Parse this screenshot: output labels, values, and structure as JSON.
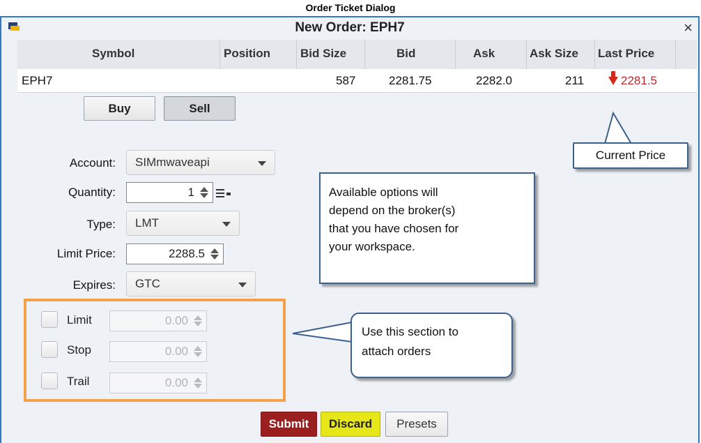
{
  "caption": "Order Ticket Dialog",
  "window": {
    "title": "New Order: EPH7",
    "close_glyph": "×"
  },
  "grid": {
    "headers": [
      "Symbol",
      "Position",
      "Bid Size",
      "Bid",
      "Ask",
      "Ask Size",
      "Last Price"
    ],
    "row": {
      "symbol": "EPH7",
      "position": "",
      "bid_size": "587",
      "bid": "2281.75",
      "ask": "2282.0",
      "ask_size": "211",
      "last_price": "2281.5",
      "last_price_direction": "down"
    }
  },
  "side_buttons": {
    "buy": "Buy",
    "sell": "Sell",
    "selected": "Sell"
  },
  "form": {
    "account_label": "Account:",
    "account_value": "SIMmwaveapi",
    "quantity_label": "Quantity:",
    "quantity_value": "1",
    "type_label": "Type:",
    "type_value": "LMT",
    "limit_price_label": "Limit Price:",
    "limit_price_value": "2288.5",
    "expires_label": "Expires:",
    "expires_value": "GTC"
  },
  "attached_orders": [
    {
      "label": "Limit",
      "value": "0.00"
    },
    {
      "label": "Stop",
      "value": "0.00"
    },
    {
      "label": "Trail",
      "value": "0.00"
    }
  ],
  "actions": {
    "submit": "Submit",
    "discard": "Discard",
    "presets": "Presets"
  },
  "callouts": {
    "current_price": "Current Price",
    "options_lines": [
      "Available options will",
      "depend on the broker(s)",
      "that you have chosen for",
      "your workspace."
    ],
    "attach_lines": [
      "Use this section to",
      "attach orders"
    ]
  },
  "colors": {
    "window_border": "#2f78c4",
    "last_price_down": "#c0272d",
    "submit": "#9b1f1f",
    "discard": "#e6e619",
    "attach_highlight": "#f5a04a",
    "callout_border": "#3d5f8c"
  },
  "icons": {
    "window": "window-app-icon",
    "close": "close-icon",
    "price_direction": "down-arrow-icon",
    "spinner": "spinner-arrows-icon",
    "dropdown": "chevron-down-icon",
    "quantity_menu": "menu-icon"
  }
}
